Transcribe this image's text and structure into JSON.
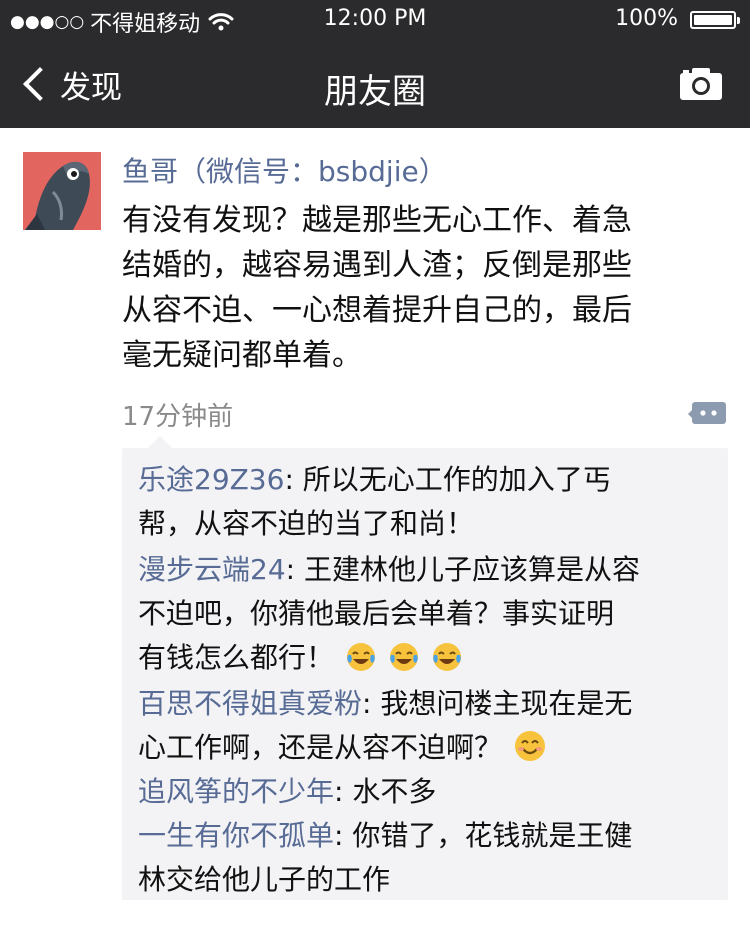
{
  "status_bar": {
    "signal_dots": "●●●○○",
    "carrier": "不得姐移动",
    "time": "12:00 PM",
    "battery": "100%",
    "icons": [
      "wifi-icon",
      "battery-icon"
    ]
  },
  "nav": {
    "back_label": "发现",
    "title": "朋友圈",
    "camera_icon": "camera-icon"
  },
  "post": {
    "username": "鱼哥（微信号：bsbdjie）",
    "lines": [
      "有没有发现？越是那些无心工作、着急",
      "结婚的，越容易遇到人渣；反倒是那些",
      "从容不迫、一心想着提升自己的，最后",
      "毫无疑问都单着。"
    ],
    "time": "17分钟前",
    "comment_icon": "comment-icon"
  },
  "comments": [
    {
      "name": "乐途29Z36",
      "lines": [
        ": 所以无心工作的加入了丐",
        "帮，从容不迫的当了和尚！"
      ]
    },
    {
      "name": "漫步云端24",
      "lines": [
        ": 王建林他儿子应该算是从容",
        "不迫吧，你猜他最后会单着？事实证明",
        "有钱怎么都行！"
      ],
      "emoji": [
        "laughing-tears-emoji",
        "laughing-tears-emoji",
        "laughing-tears-emoji"
      ]
    },
    {
      "name": "百思不得姐真爱粉",
      "lines": [
        ": 我想问楼主现在是无",
        "心工作啊，还是从容不迫啊？"
      ],
      "emoji": [
        "smile-emoji"
      ]
    },
    {
      "name": "追风筝的不少年",
      "lines": [
        ": 水不多"
      ]
    },
    {
      "name": "一生有你不孤单",
      "lines": [
        ": 你错了，花钱就是王健",
        "林交给他儿子的工作"
      ]
    }
  ],
  "colors": {
    "bar_background": "#2b2b2d",
    "name_blue": "#576b95",
    "comment_background": "#f3f3f5"
  }
}
